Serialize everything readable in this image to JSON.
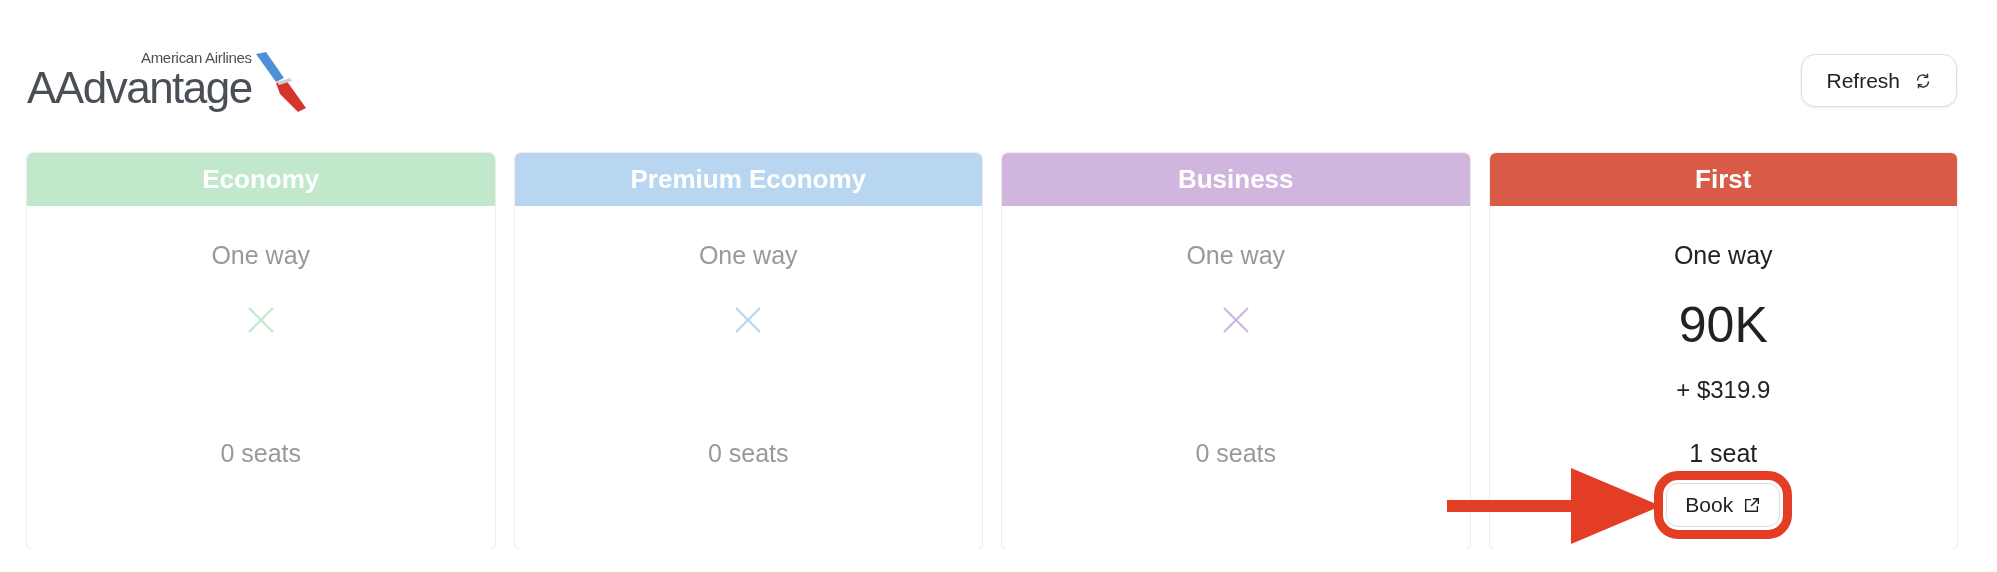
{
  "logo": {
    "airline": "American Airlines",
    "program": "AAdvantage"
  },
  "refresh_button": {
    "label": "Refresh"
  },
  "cards": [
    {
      "cabin": "Economy",
      "color": "#c2e8cb",
      "available": false,
      "trip": "One way",
      "seats": "0 seats"
    },
    {
      "cabin": "Premium Economy",
      "color": "#b9d6f0",
      "available": false,
      "trip": "One way",
      "seats": "0 seats"
    },
    {
      "cabin": "Business",
      "color": "#d0b6de",
      "available": false,
      "trip": "One way",
      "seats": "0 seats"
    },
    {
      "cabin": "First",
      "color": "#d95a47",
      "available": true,
      "trip": "One way",
      "miles": "90K",
      "fees": "+ $319.9",
      "seats": "1 seat",
      "book_button": "Book",
      "highlighted": true
    }
  ]
}
